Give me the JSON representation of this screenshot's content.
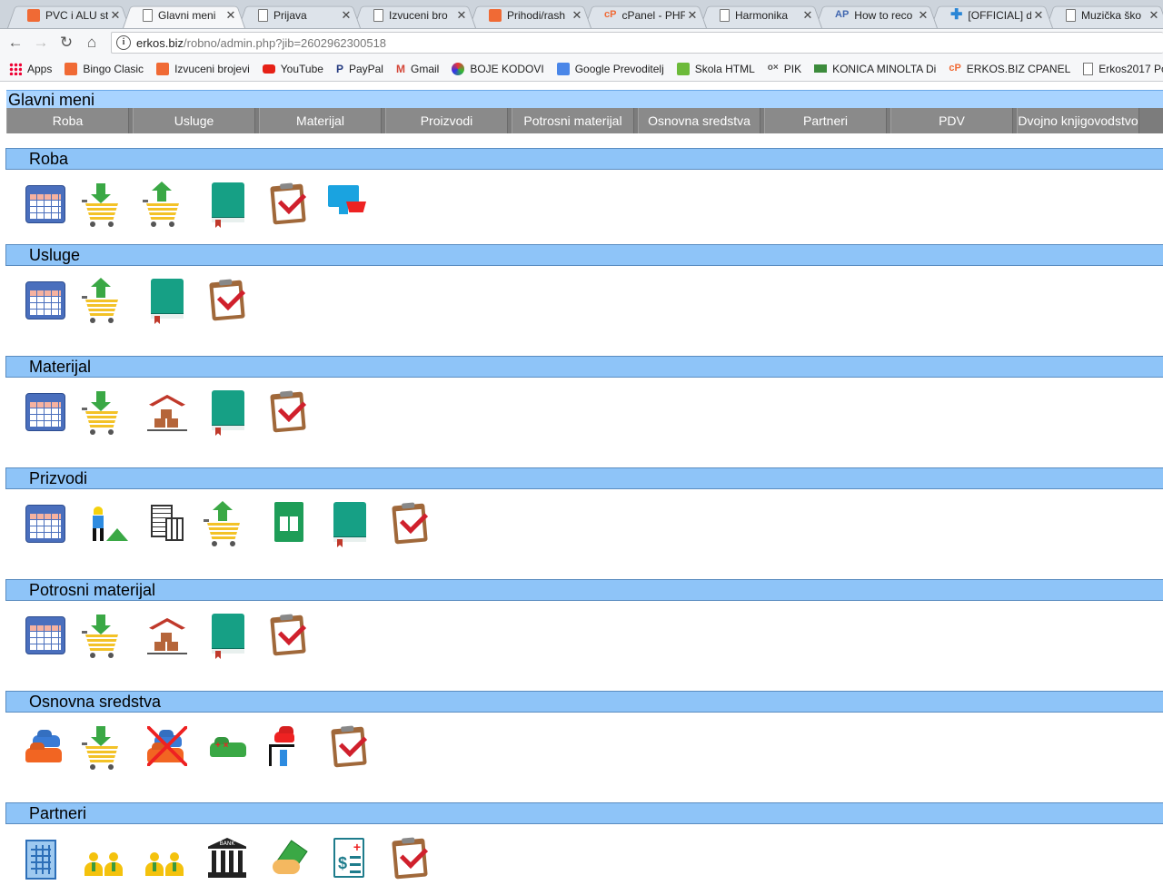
{
  "browser": {
    "tabs": [
      {
        "title": "PVC i ALU st",
        "icon": "orange-square-icon",
        "active": false
      },
      {
        "title": "Glavni meni",
        "icon": "page-icon",
        "active": true
      },
      {
        "title": "Prijava",
        "icon": "page-icon",
        "active": false
      },
      {
        "title": "Izvuceni bro",
        "icon": "page-icon",
        "active": false
      },
      {
        "title": "Prihodi/rash",
        "icon": "orange-square-icon",
        "active": false
      },
      {
        "title": "cPanel - PHF",
        "icon": "cpanel-icon",
        "active": false
      },
      {
        "title": "Harmonika",
        "icon": "page-icon",
        "active": false
      },
      {
        "title": "How to reco",
        "icon": "ap-icon",
        "active": false
      },
      {
        "title": "[OFFICIAL] d",
        "icon": "plus-icon",
        "active": false
      },
      {
        "title": "Muzička ško",
        "icon": "page-icon",
        "active": false
      }
    ],
    "close_glyph": "✕",
    "url_host": "erkos.biz",
    "url_path": "/robno/admin.php?jib=2602962300518",
    "bookmarks": [
      {
        "label": "Apps",
        "icon": "apps-grid-icon"
      },
      {
        "label": "Bingo Clasic",
        "icon": "orange-square-icon"
      },
      {
        "label": "Izvuceni brojevi",
        "icon": "orange-square-icon"
      },
      {
        "label": "YouTube",
        "icon": "youtube-icon"
      },
      {
        "label": "PayPal",
        "icon": "paypal-icon"
      },
      {
        "label": "Gmail",
        "icon": "gmail-icon"
      },
      {
        "label": "BOJE KODOVI",
        "icon": "color-wheel-icon"
      },
      {
        "label": "Google Prevoditelj",
        "icon": "translate-icon"
      },
      {
        "label": "Skola HTML",
        "icon": "w3-icon"
      },
      {
        "label": "PIK",
        "icon": "pik-icon"
      },
      {
        "label": "KONICA MINOLTA Di",
        "icon": "printer-icon"
      },
      {
        "label": "ERKOS.BIZ CPANEL",
        "icon": "cpanel-icon"
      },
      {
        "label": "Erkos2017 Po",
        "icon": "page-icon"
      }
    ],
    "bookmark_glyphs": {
      "pp": "P",
      "gm": "M",
      "pik": "o×",
      "cp": "cP"
    }
  },
  "page": {
    "title": "Glavni meni",
    "menu": [
      "Roba",
      "Usluge",
      "Materijal",
      "Proizvodi",
      "Potrosni materijal",
      "Osnovna sredstva",
      "Partneri",
      "PDV",
      "Dvojno knjigovodstvo"
    ],
    "sections": [
      {
        "name": "Roba",
        "icons": [
          "calendar-table-icon",
          "cart-download-icon",
          "cart-upload-icon",
          "book-icon",
          "clipboard-check-icon",
          "monitor-cart-icon"
        ]
      },
      {
        "name": "Usluge",
        "icons": [
          "calendar-table-icon",
          "cart-upload-icon",
          "book-icon",
          "clipboard-check-icon"
        ]
      },
      {
        "name": "Materijal",
        "icons": [
          "calendar-table-icon",
          "cart-download-icon",
          "warehouse-icon",
          "book-icon",
          "clipboard-check-icon"
        ]
      },
      {
        "name": "Prizvodi",
        "icons": [
          "calendar-table-icon",
          "worker-icon",
          "calculator-receipt-icon",
          "cart-upload-icon",
          "spreadsheet-icon",
          "book-icon",
          "clipboard-check-icon"
        ]
      },
      {
        "name": "Potrosni materijal",
        "icons": [
          "calendar-table-icon",
          "cart-download-icon",
          "warehouse-icon",
          "book-icon",
          "clipboard-check-icon"
        ]
      },
      {
        "name": "Osnovna sredstva",
        "icons": [
          "cars-icon",
          "cart-download-icon",
          "cars-crossed-icon",
          "car-repair-icon",
          "car-lift-icon",
          "clipboard-check-icon"
        ]
      },
      {
        "name": "Partneri",
        "icons": [
          "building-icon",
          "people-icon",
          "people-icon",
          "bank-icon",
          "money-hand-icon",
          "invoice-icon",
          "clipboard-check-icon"
        ]
      }
    ],
    "bank_label": "BANK"
  }
}
